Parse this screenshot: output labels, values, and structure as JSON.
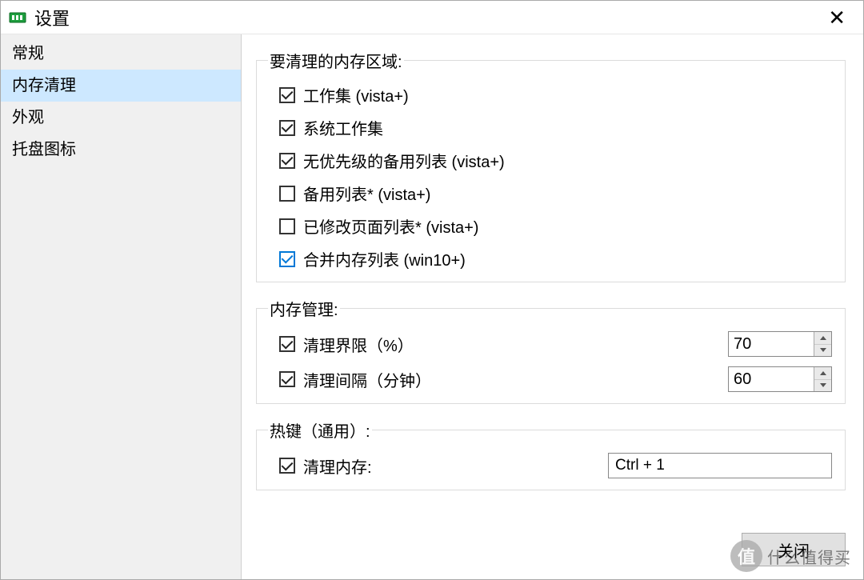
{
  "window": {
    "title": "设置",
    "close_label": "✕"
  },
  "sidebar": {
    "items": [
      {
        "label": "常规",
        "selected": false
      },
      {
        "label": "内存清理",
        "selected": true
      },
      {
        "label": "外观",
        "selected": false
      },
      {
        "label": "托盘图标",
        "selected": false
      }
    ]
  },
  "groups": {
    "clean_areas": {
      "legend": "要清理的内存区域:",
      "options": [
        {
          "label": "工作集 (vista+)",
          "checked": true,
          "blue": false
        },
        {
          "label": "系统工作集",
          "checked": true,
          "blue": false
        },
        {
          "label": "无优先级的备用列表 (vista+)",
          "checked": true,
          "blue": false
        },
        {
          "label": "备用列表* (vista+)",
          "checked": false,
          "blue": false
        },
        {
          "label": "已修改页面列表* (vista+)",
          "checked": false,
          "blue": false
        },
        {
          "label": "合并内存列表 (win10+)",
          "checked": true,
          "blue": true
        }
      ]
    },
    "mem_mgmt": {
      "legend": "内存管理:",
      "rows": [
        {
          "label": "清理界限（%）",
          "checked": true,
          "value": "70"
        },
        {
          "label": "清理间隔（分钟）",
          "checked": true,
          "value": "60"
        }
      ]
    },
    "hotkey": {
      "legend": "热键（通用）:",
      "rows": [
        {
          "label": "清理内存:",
          "checked": true,
          "value": "Ctrl + 1"
        }
      ]
    }
  },
  "buttons": {
    "close": "关闭"
  },
  "watermark": {
    "badge": "值",
    "text": "什么值得买"
  }
}
